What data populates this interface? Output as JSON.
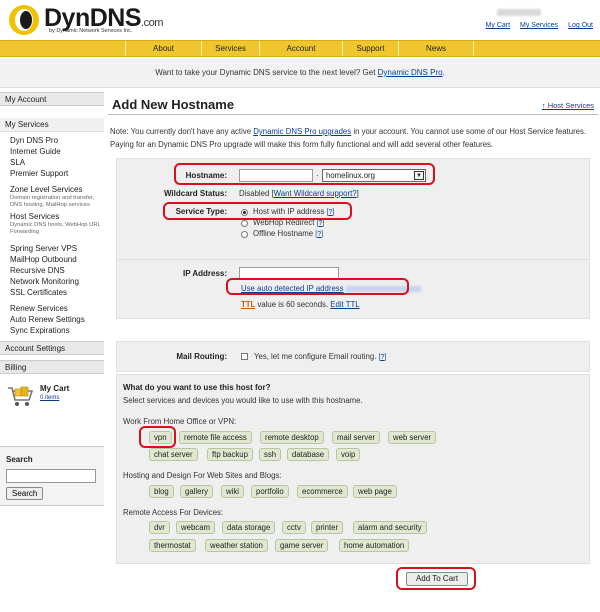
{
  "header": {
    "brand": "DynDNS",
    "brand_suffix": ".com",
    "tagline": "by Dynamic Network Services Inc.",
    "links": [
      "My Cart",
      "My Services",
      "Log Out"
    ]
  },
  "nav": [
    "About",
    "Services",
    "Account",
    "Support",
    "News"
  ],
  "promo": {
    "text": "Want to take your Dynamic DNS service to the next level? Get ",
    "link": "Dynamic DNS Pro",
    "end": "."
  },
  "sidebar": {
    "account_heading": "My Account",
    "my_services": "My Services",
    "group1": [
      "Dyn DNS Pro",
      "Internet Guide",
      "SLA",
      "Premier Support"
    ],
    "zone_title": "Zone Level Services",
    "zone_desc": "Domain registration and transfer, DNS hosting, MailHop services",
    "host_title": "Host Services",
    "host_desc": "Dynamic DNS hosts, WebHop URL Forwarding",
    "group2": [
      "Spring Server VPS",
      "MailHop Outbound",
      "Recursive DNS",
      "Network Monitoring",
      "SSL Certificates"
    ],
    "group3": [
      "Renew Services",
      "Auto Renew Settings",
      "Sync Expirations"
    ],
    "account_settings": "Account Settings",
    "billing": "Billing",
    "cart_label": "My Cart",
    "cart_items": "0 items",
    "search_title": "Search",
    "search_button": "Search"
  },
  "main": {
    "title": "Add New Hostname",
    "host_services_link": "↑ Host Services",
    "note_1": "Note: You currently don't have any active ",
    "note_link": "Dynamic DNS Pro upgrades",
    "note_2": " in your account. You cannot use some of our Host Service features. Paying for an Dynamic DNS Pro upgrade will make this form fully functional and will add several other features.",
    "hostname_label": "Hostname:",
    "hostname_value": "",
    "dot": "·",
    "domain_selected": "homelinux.org",
    "wildcard_label": "Wildcard Status:",
    "wildcard_value": "Disabled [",
    "wildcard_link": "Want Wildcard support?",
    "wildcard_end": "]",
    "service_type_label": "Service Type:",
    "service_types": [
      "Host with IP address",
      "WebHop Redirect",
      "Offline Hostname"
    ],
    "help": "?",
    "ip_label": "IP Address:",
    "ip_value": "",
    "auto_detect": "Use auto detected IP address",
    "ttl_link": "TTL",
    "ttl_text": " value is 60 seconds. ",
    "edit_ttl": "Edit TTL",
    "mail_label": "Mail Routing:",
    "mail_text": "Yes, let me configure Email routing.",
    "use_title": "What do you want to use this host for?",
    "use_desc": "Select services and devices you would like to use with this hostname.",
    "groups": [
      {
        "title": "Work From Home Office or VPN:",
        "tags": [
          "vpn",
          "remote file access",
          "remote desktop",
          "mail server",
          "web server",
          "chat server",
          "ftp backup",
          "ssh",
          "database",
          "voip"
        ]
      },
      {
        "title": "Hosting and Design For Web Sites and Blogs:",
        "tags": [
          "blog",
          "gallery",
          "wiki",
          "portfolio",
          "ecommerce",
          "web page"
        ]
      },
      {
        "title": "Remote Access For Devices:",
        "tags": [
          "dvr",
          "webcam",
          "data storage",
          "cctv",
          "printer",
          "alarm and security",
          "thermostat",
          "weather station",
          "game server",
          "home automation"
        ]
      }
    ],
    "add_to_cart": "Add To Cart"
  },
  "colors": {
    "nav_bg": "#f0c62e",
    "link": "#0a3d91",
    "highlight": "#d6121f",
    "tag_bg": "#e1e8d2"
  }
}
